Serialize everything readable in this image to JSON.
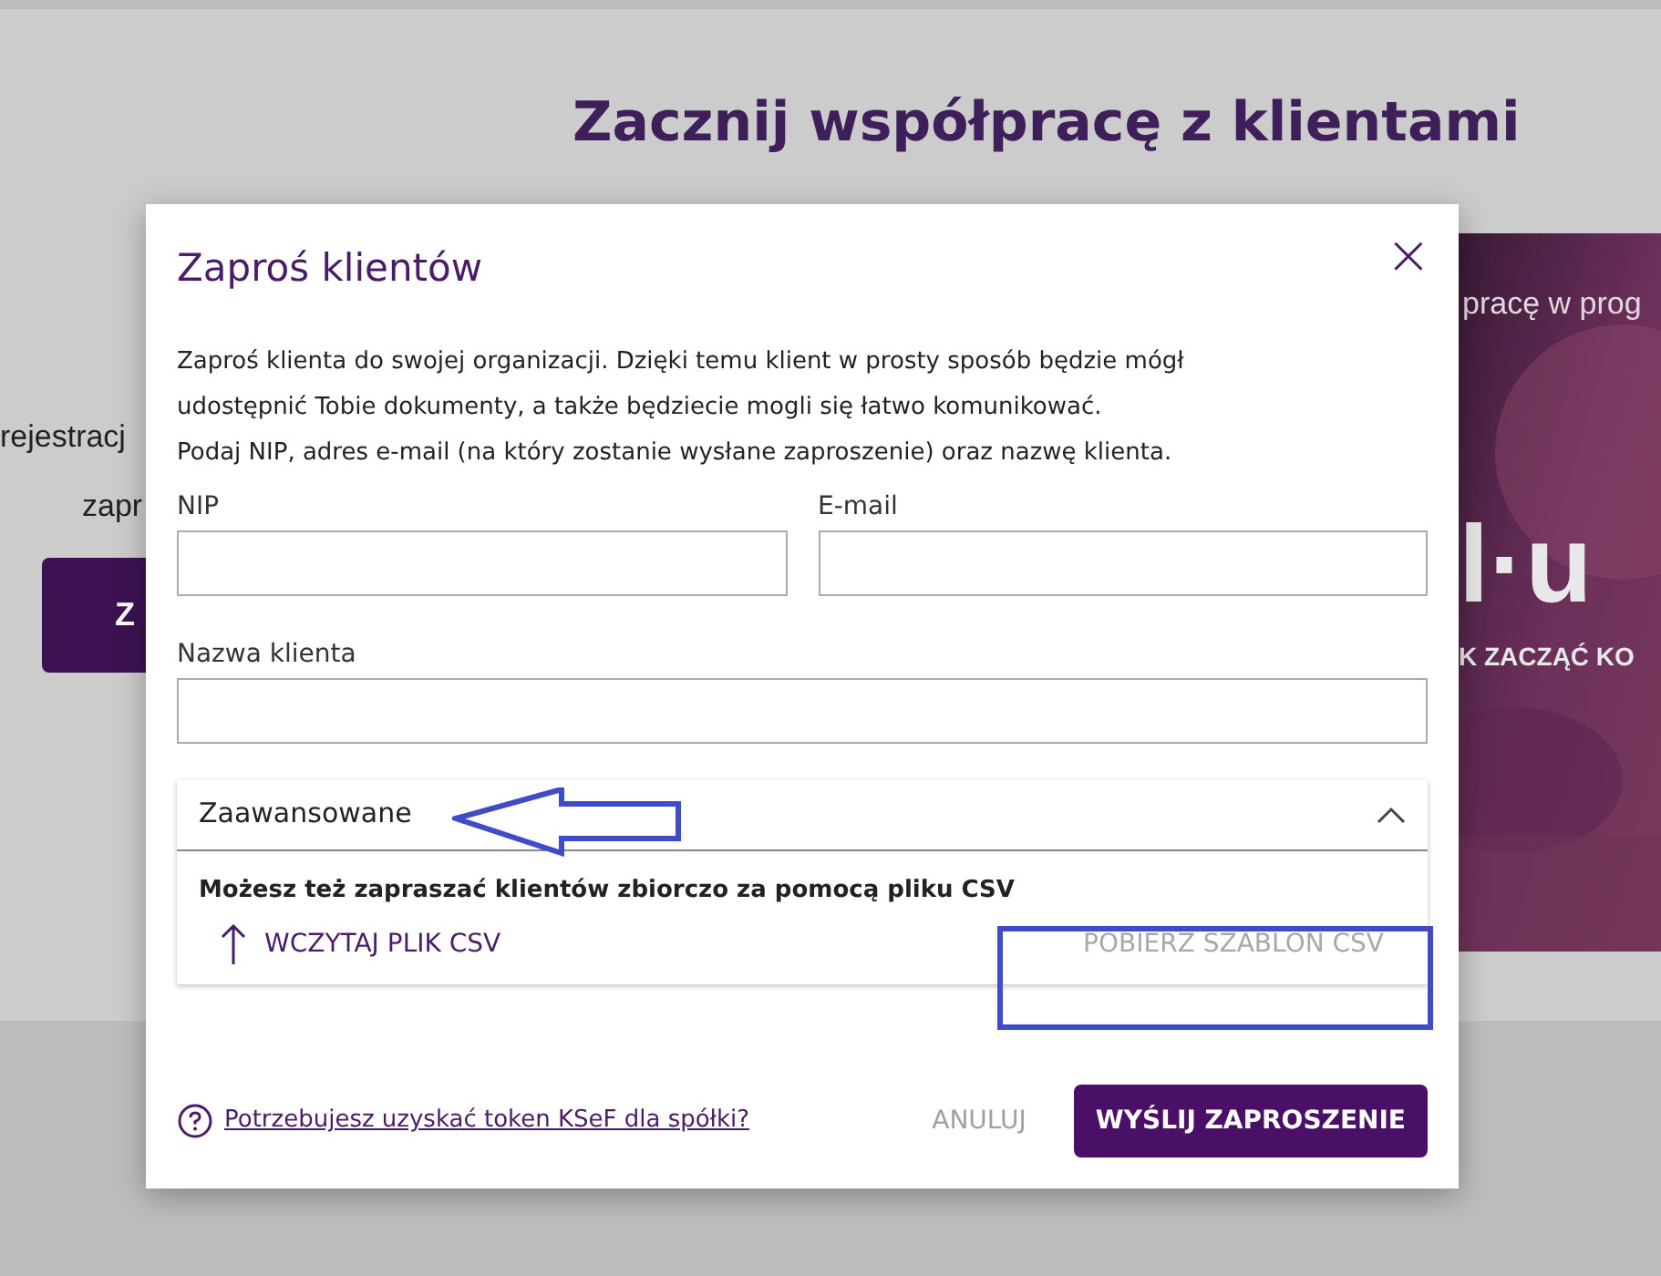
{
  "page": {
    "title": "Zacznij współpracę z klientami",
    "left_text_1": "rejestracj",
    "left_text_2": "zapr",
    "left_button": "Z",
    "promo": {
      "line_1": "pracę w prog",
      "logo": "l·u",
      "line_2": "K ZACZĄĆ KO"
    }
  },
  "dialog": {
    "title": "Zaproś klientów",
    "close": "×",
    "intro": [
      "Zaproś klienta do swojej organizacji. Dzięki temu klient w prosty sposób będzie mógł",
      "udostępnić Tobie dokumenty, a także będziecie mogli się łatwo komunikować.",
      "Podaj NIP, adres e-mail (na który zostanie wysłane zaproszenie) oraz nazwę klienta."
    ],
    "fields": [
      {
        "label": "NIP"
      },
      {
        "label": "E-mail"
      }
    ],
    "name_field": {
      "label": "Nazwa klienta"
    },
    "advanced": {
      "title": "Zaawansowane",
      "expanded": true,
      "description": "Możesz też zapraszać klientów zbiorczo za pomocą pliku CSV",
      "upload": "WCZYTAJ PLIK CSV",
      "download": {
        "label": "POBIERZ SZABLON CSV",
        "disabled": true
      }
    },
    "help_link": "Potrzebujesz uzyskać token KSeF dla spółki?",
    "cancel": "ANULUJ",
    "submit": "WYŚLIJ ZAPROSZENIE"
  }
}
